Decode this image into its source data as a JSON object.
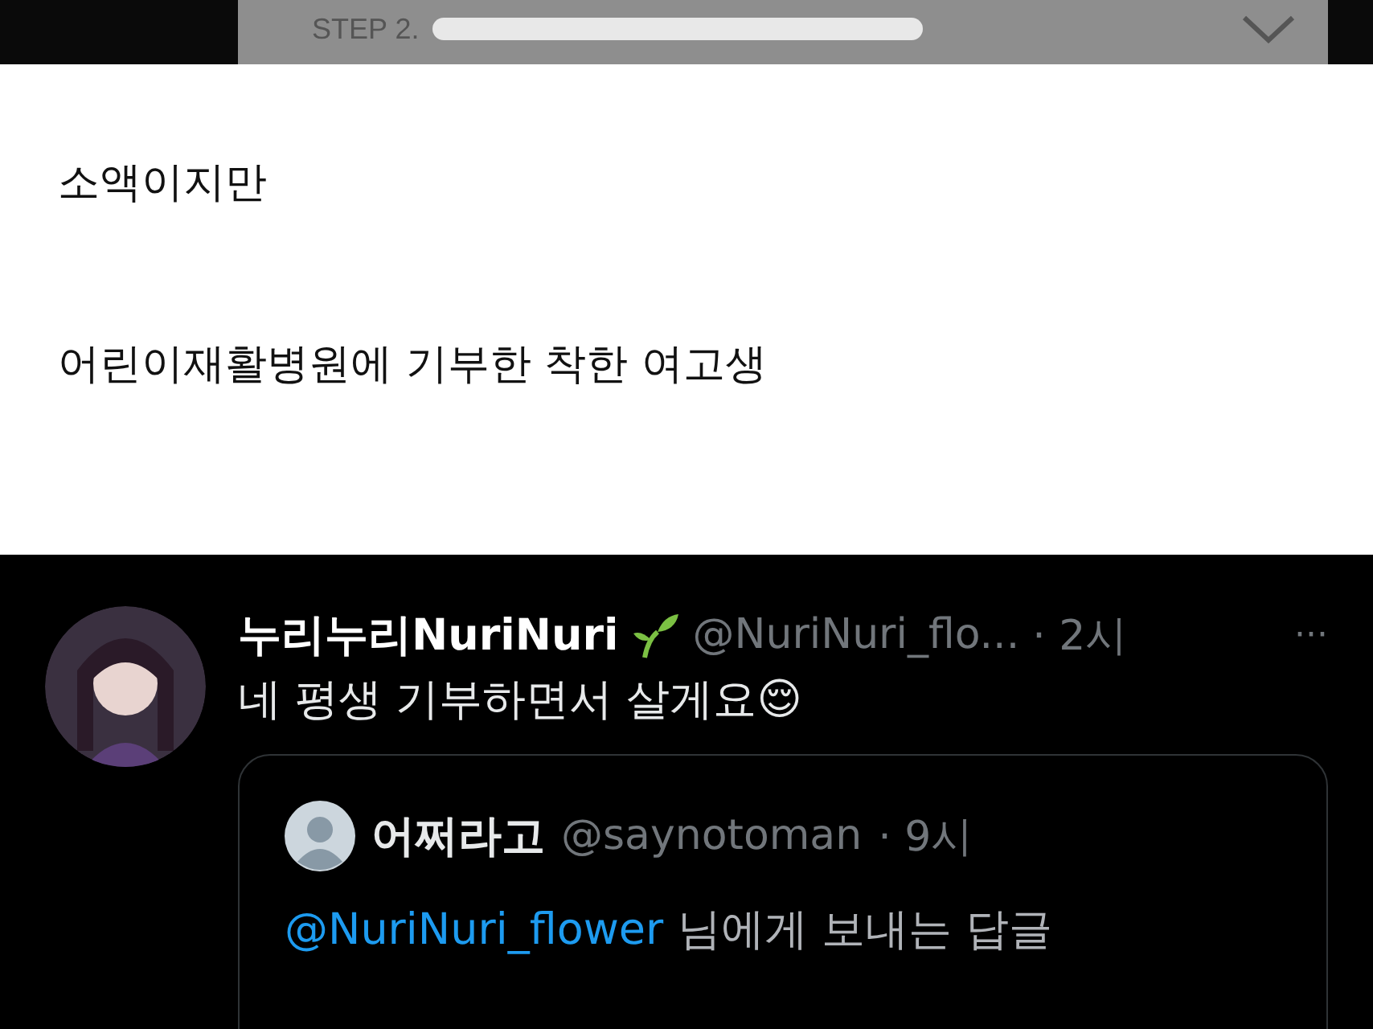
{
  "top_card": {
    "step_label": "STEP 2."
  },
  "post": {
    "lines": [
      "소액이지만",
      "어린이재활병원에 기부한 착한 여고생"
    ]
  },
  "reply": {
    "display_name": "누리누리NuriNuri",
    "handle": "@NuriNuri_flo...",
    "time": "· 2시",
    "more": "···",
    "text": "네 평생 기부하면서 살게요",
    "emoji": "😌",
    "quoted": {
      "display_name": "어쩌라고",
      "handle": "@saynotoman",
      "time": "· 9시",
      "mention": "@NuriNuri_flower",
      "reply_text": "님에게 보내는 답글"
    }
  }
}
